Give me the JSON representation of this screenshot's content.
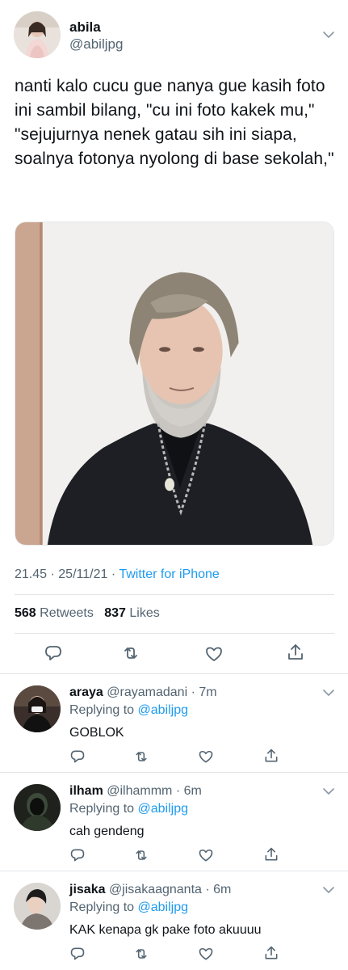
{
  "tweet": {
    "author_name": "abila",
    "author_handle": "@abiljpg",
    "text": "nanti kalo cucu gue nanya gue kasih foto ini sambil bilang, \"cu ini foto kakek mu,\" \"sejujurnya nenek gatau sih ini siapa, soalnya fotonya nyolong di base sekolah,\"",
    "time": "21.45",
    "date": "25/11/21",
    "source": "Twitter for iPhone",
    "retweets_count": "568",
    "retweets_label": "Retweets",
    "likes_count": "837",
    "likes_label": "Likes"
  },
  "replies": [
    {
      "name": "araya",
      "handle": "@rayamadani",
      "time": "7m",
      "replying_label": "Replying to",
      "replying_to": "@abiljpg",
      "text": "GOBLOK"
    },
    {
      "name": "ilham",
      "handle": "@ilhammm",
      "time": "6m",
      "replying_label": "Replying to",
      "replying_to": "@abiljpg",
      "text": "cah gendeng"
    },
    {
      "name": "jisaka",
      "handle": "@jisakaagnanta",
      "time": "6m",
      "replying_label": "Replying to",
      "replying_to": "@abiljpg",
      "text": "KAK kenapa gk pake foto akuuuu"
    }
  ],
  "colors": {
    "accent": "#1d9bf0",
    "secondary_text": "#536471",
    "primary_text": "#0f1419",
    "divider": "#e1e5e8"
  },
  "icons": {
    "more": "chevron-down-icon",
    "reply": "reply-icon",
    "retweet": "retweet-icon",
    "like": "heart-icon",
    "share": "share-icon"
  }
}
